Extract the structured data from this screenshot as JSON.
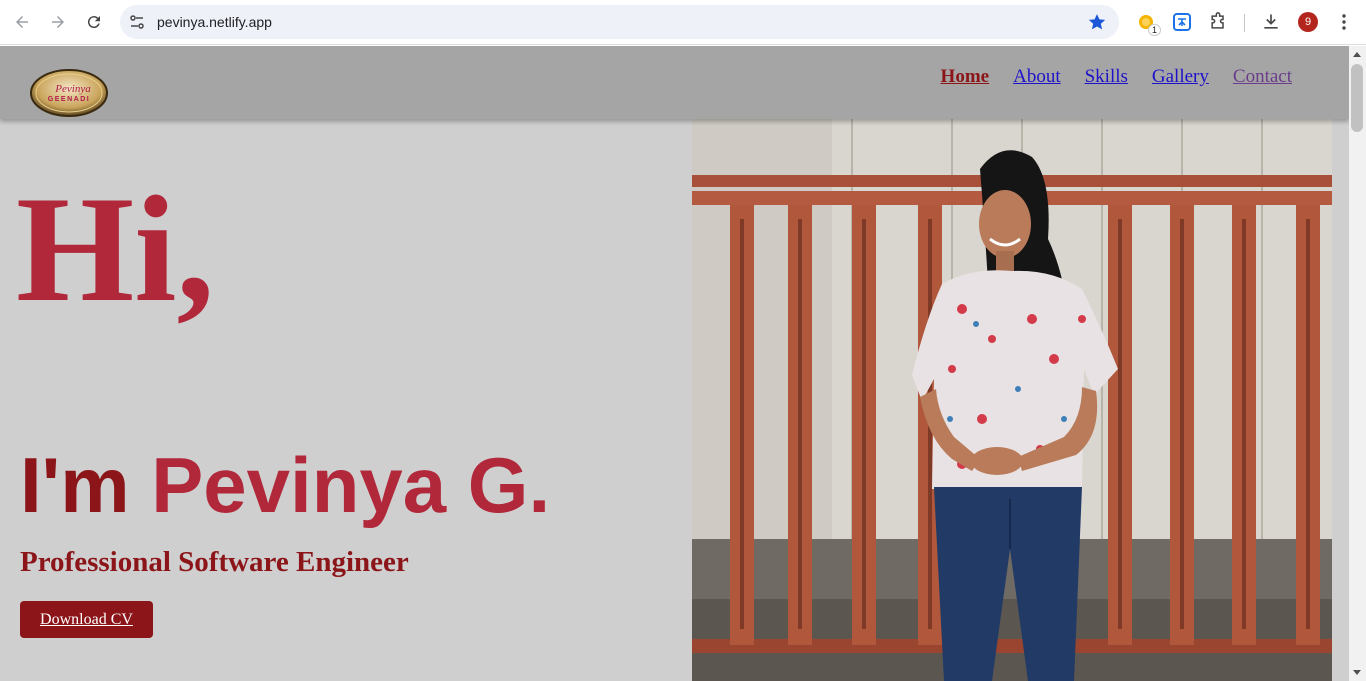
{
  "browser": {
    "url": "pevinya.netlify.app",
    "extension_badge": "1",
    "profile_initial": "9"
  },
  "header": {
    "logo_text": "Pevinya GEENADI",
    "nav": [
      "Home",
      "About",
      "Skills",
      "Gallery",
      "Contact"
    ]
  },
  "hero": {
    "greeting": "Hi,",
    "intro_lead": "I'm ",
    "intro_name": "Pevinya G.",
    "role": "Professional Software Engineer",
    "cv_button": "Download CV"
  },
  "colors": {
    "accent": "#b1283a",
    "dark_accent": "#8b1518",
    "page_bg": "#d0cfd0",
    "header_bg": "#a6a5a6"
  }
}
